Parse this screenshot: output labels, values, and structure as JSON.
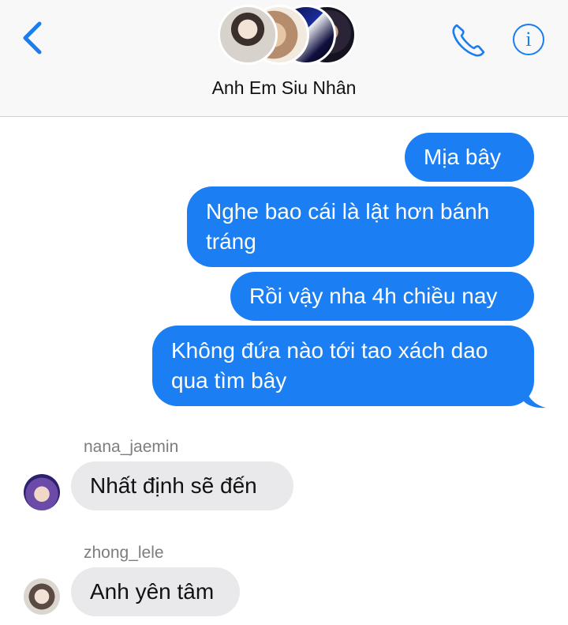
{
  "header": {
    "group_name": "Anh Em Siu Nhân",
    "info_glyph": "i",
    "icons": {
      "back": "chevron-left-icon",
      "call": "phone-icon",
      "info": "info-icon"
    }
  },
  "colors": {
    "accent": "#1a7df0",
    "outgoing_bubble": "#1b7ef3",
    "incoming_bubble": "#e9e9eb"
  },
  "messages": {
    "outgoing": [
      {
        "text": "Mịa bây"
      },
      {
        "text": "Nghe bao cái là lật hơn bánh tráng"
      },
      {
        "text": "Rồi vậy nha 4h chiều nay"
      },
      {
        "text": "Không đứa nào tới tao xách dao qua tìm bây"
      }
    ],
    "incoming": [
      {
        "sender": "nana_jaemin",
        "text": "Nhất định sẽ đến"
      },
      {
        "sender": "zhong_lele",
        "text": "Anh yên tâm"
      }
    ]
  }
}
